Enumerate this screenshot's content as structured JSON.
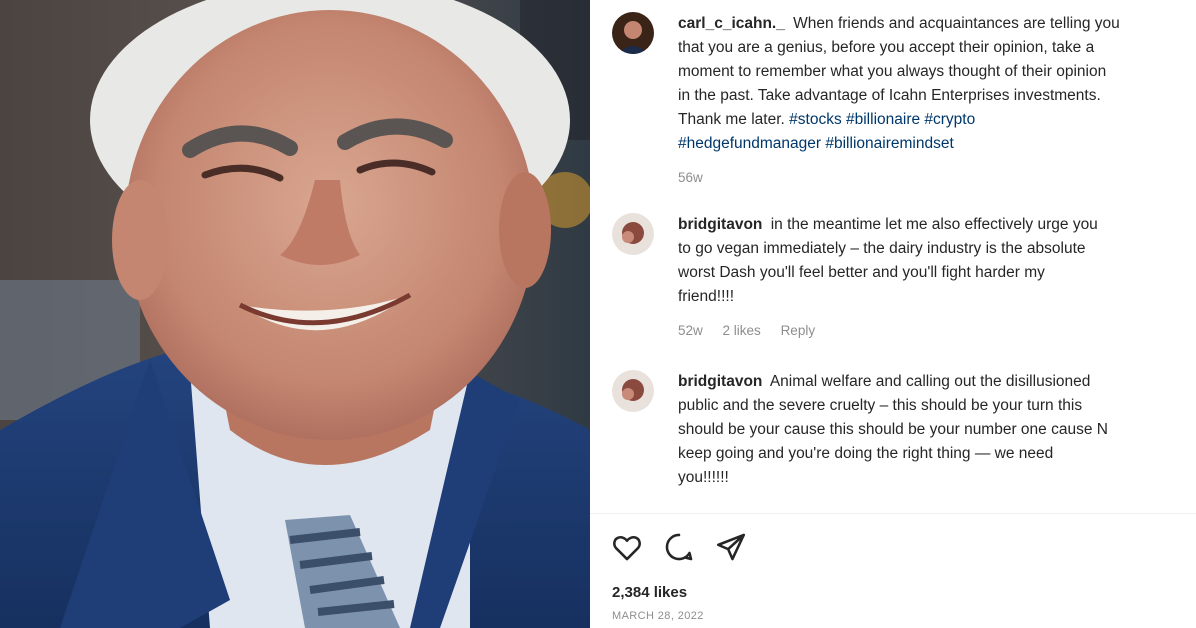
{
  "post": {
    "caption": {
      "username": "carl_c_icahn._",
      "lines": [
        "When friends and acquaintances are telling you",
        "that you are a genius, before you accept their opinion, take a",
        "moment to remember what you always thought of their opinion",
        "in the past. Take advantage of Icahn Enterprises investments.",
        "Thank me later."
      ],
      "hashtags_line1": "#stocks #billionaire #crypto",
      "hashtags_line2": "#hedgefundmanager #billionairemindset",
      "time": "56w"
    },
    "comments": [
      {
        "username": "bridgitavon",
        "lines": [
          "in the meantime let me also effectively urge you",
          "to go vegan immediately – the dairy industry is the absolute",
          "worst Dash you'll feel better and you'll fight harder my",
          "friend!!!!"
        ],
        "time": "52w",
        "likes": "2 likes",
        "reply": "Reply"
      },
      {
        "username": "bridgitavon",
        "lines": [
          "Animal welfare and calling out the disillusioned",
          "public and the severe cruelty – this should be your turn this",
          "should be your cause this should be your number one cause N",
          "keep going and you're doing the right thing — we need",
          "you!!!!!!"
        ]
      }
    ],
    "likes_count": "2,384 likes",
    "date": "MARCH 28, 2022"
  },
  "icons": {
    "like": "heart-icon",
    "comment": "comment-bubble-icon",
    "share": "paper-plane-icon"
  },
  "colors": {
    "hashtag": "#00376b",
    "meta_text": "#8e8e8e",
    "suit": "#1c3a73"
  }
}
